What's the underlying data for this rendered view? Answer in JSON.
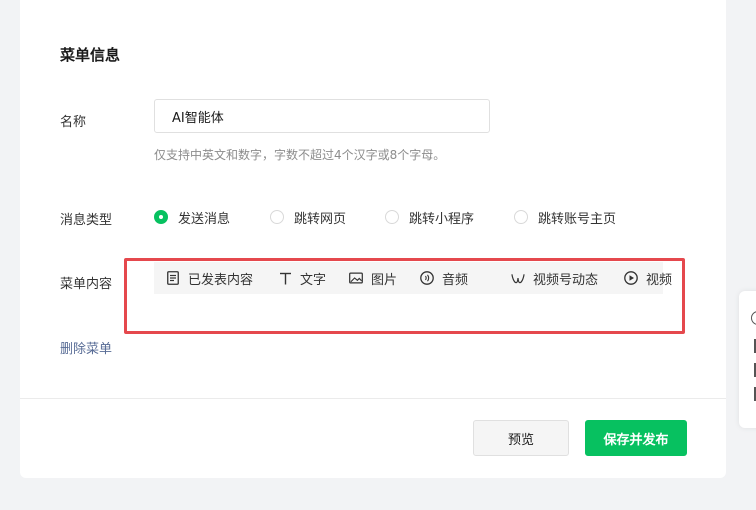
{
  "section": {
    "title": "菜单信息"
  },
  "name_field": {
    "label": "名称",
    "value": "AI智能体",
    "hint": "仅支持中英文和数字，字数不超过4个汉字或8个字母。"
  },
  "message_type": {
    "label": "消息类型",
    "options": [
      {
        "label": "发送消息",
        "checked": true
      },
      {
        "label": "跳转网页",
        "checked": false
      },
      {
        "label": "跳转小程序",
        "checked": false
      },
      {
        "label": "跳转账号主页",
        "checked": false
      }
    ]
  },
  "menu_content": {
    "label": "菜单内容",
    "tools": [
      {
        "label": "已发表内容",
        "icon": "document-icon"
      },
      {
        "label": "文字",
        "icon": "text-icon"
      },
      {
        "label": "图片",
        "icon": "image-icon"
      },
      {
        "label": "音频",
        "icon": "audio-icon"
      },
      {
        "label": "视频号动态",
        "icon": "channels-icon"
      },
      {
        "label": "视频",
        "icon": "play-icon"
      }
    ]
  },
  "delete_link": "删除菜单",
  "buttons": {
    "preview": "预览",
    "publish": "保存并发布"
  },
  "colors": {
    "accent_green": "#07c160",
    "link_blue": "#576b95",
    "highlight_red": "#e5484d"
  }
}
